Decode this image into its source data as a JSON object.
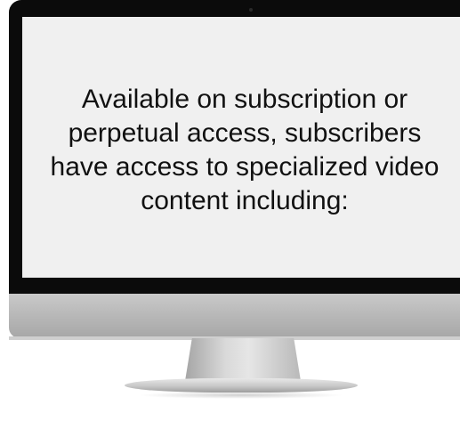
{
  "screen": {
    "text": "Available on subscription or perpetual access, subscribers have access to specialized video content including:"
  }
}
